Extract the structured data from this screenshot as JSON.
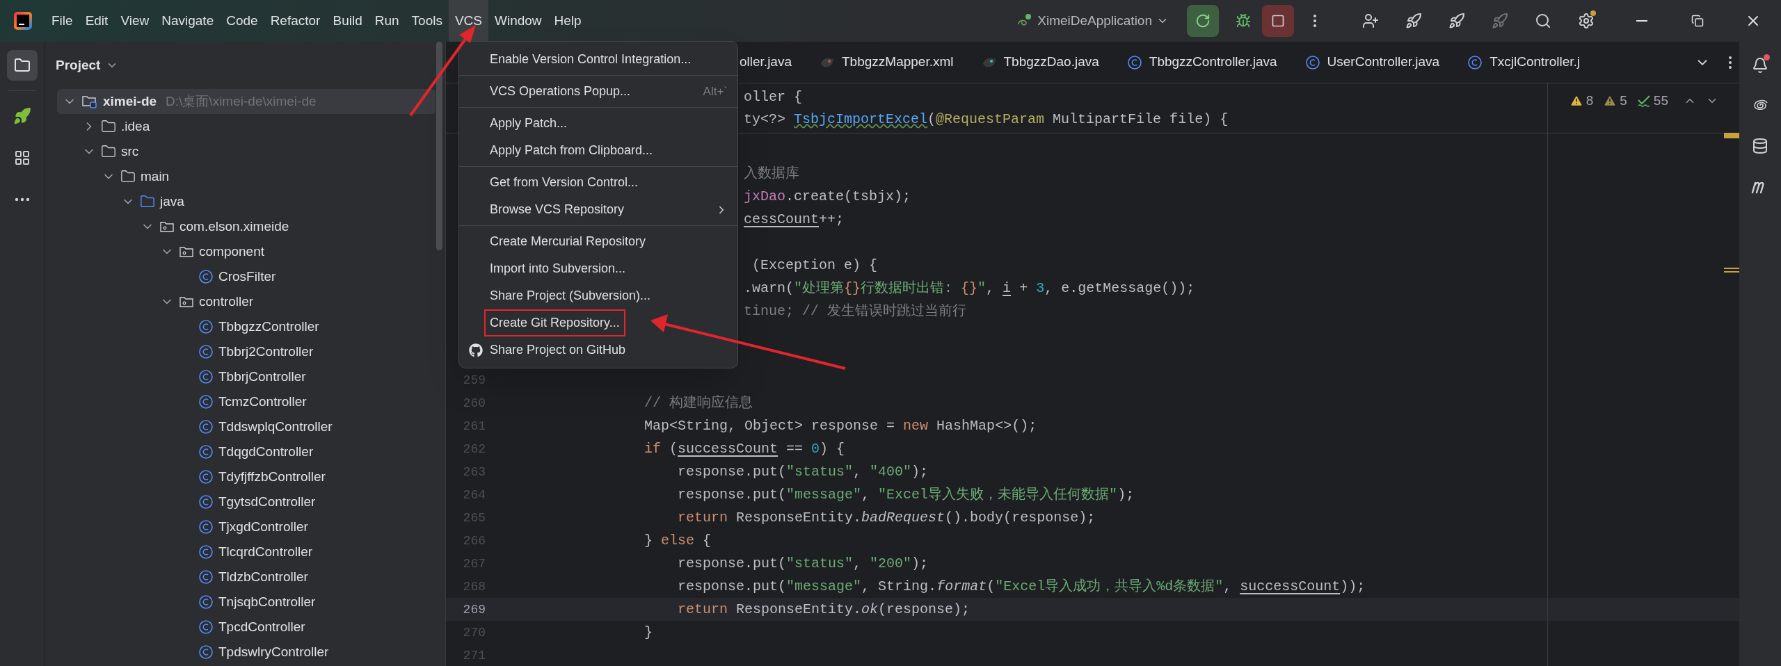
{
  "menu_bar": {
    "items": [
      {
        "label": "File",
        "selected": false
      },
      {
        "label": "Edit",
        "selected": false
      },
      {
        "label": "View",
        "selected": false
      },
      {
        "label": "Navigate",
        "selected": false
      },
      {
        "label": "Code",
        "selected": false
      },
      {
        "label": "Refactor",
        "selected": false
      },
      {
        "label": "Build",
        "selected": false
      },
      {
        "label": "Run",
        "selected": false
      },
      {
        "label": "Tools",
        "selected": false
      },
      {
        "label": "VCS",
        "selected": true
      },
      {
        "label": "Window",
        "selected": false
      },
      {
        "label": "Help",
        "selected": false
      }
    ]
  },
  "run_config": {
    "label": "XimeiDeApplication"
  },
  "project_panel": {
    "title": "Project",
    "tree": [
      {
        "label": "ximei-de",
        "path": "D:\\桌面\\ximei-de\\ximei-de",
        "kind": "module",
        "expanded": true,
        "selected": true,
        "children": [
          {
            "label": ".idea",
            "kind": "folder",
            "expanded": false,
            "selected": false
          },
          {
            "label": "src",
            "kind": "folder",
            "expanded": true,
            "selected": false,
            "children": [
              {
                "label": "main",
                "kind": "folder",
                "expanded": true,
                "selected": false,
                "children": [
                  {
                    "label": "java",
                    "kind": "source-root",
                    "expanded": true,
                    "selected": false,
                    "children": [
                      {
                        "label": "com.elson.ximeide",
                        "kind": "package",
                        "expanded": true,
                        "selected": false,
                        "children": [
                          {
                            "label": "component",
                            "kind": "package",
                            "expanded": true,
                            "selected": false,
                            "children": [
                              {
                                "label": "CrosFilter",
                                "kind": "class",
                                "selected": false
                              }
                            ]
                          },
                          {
                            "label": "controller",
                            "kind": "package",
                            "expanded": true,
                            "selected": false,
                            "children": [
                              {
                                "label": "TbbgzzController",
                                "kind": "class",
                                "selected": false
                              },
                              {
                                "label": "Tbbrj2Controller",
                                "kind": "class",
                                "selected": false
                              },
                              {
                                "label": "TbbrjController",
                                "kind": "class",
                                "selected": false
                              },
                              {
                                "label": "TcmzController",
                                "kind": "class",
                                "selected": false
                              },
                              {
                                "label": "TddswplqController",
                                "kind": "class",
                                "selected": false
                              },
                              {
                                "label": "TdqgdController",
                                "kind": "class",
                                "selected": false
                              },
                              {
                                "label": "TdyfjffzbController",
                                "kind": "class",
                                "selected": false
                              },
                              {
                                "label": "TgytsdController",
                                "kind": "class",
                                "selected": false
                              },
                              {
                                "label": "TjxgdController",
                                "kind": "class",
                                "selected": false
                              },
                              {
                                "label": "TlcqrdController",
                                "kind": "class",
                                "selected": false
                              },
                              {
                                "label": "TldzbController",
                                "kind": "class",
                                "selected": false
                              },
                              {
                                "label": "TnjsqbController",
                                "kind": "class",
                                "selected": false
                              },
                              {
                                "label": "TpcdController",
                                "kind": "class",
                                "selected": false
                              },
                              {
                                "label": "TpdswlryController",
                                "kind": "class",
                                "selected": false
                              }
                            ]
                          }
                        ]
                      }
                    ]
                  }
                ]
              }
            ]
          }
        ]
      }
    ]
  },
  "editor_tabs": [
    {
      "label": "oller.java",
      "kind": "plain"
    },
    {
      "label": "TbbgzzMapper.xml",
      "kind": "mapper"
    },
    {
      "label": "TbbgzzDao.java",
      "kind": "dao"
    },
    {
      "label": "TbbgzzController.java",
      "kind": "class"
    },
    {
      "label": "UserController.java",
      "kind": "class"
    },
    {
      "label": "TxcjlController.j",
      "kind": "class"
    }
  ],
  "inspections": [
    {
      "kind": "warning",
      "count": "8"
    },
    {
      "kind": "weak-warning",
      "count": "5"
    },
    {
      "kind": "typo",
      "count": "55"
    }
  ],
  "sticky_lines": [
    {
      "tokens": [
        {
          "kind": "plain",
          "text": "oller {"
        }
      ]
    },
    {
      "tokens": [
        {
          "kind": "plain",
          "text": "ty<?> "
        },
        {
          "kind": "decl",
          "text": "TsbjcImportExcel"
        },
        {
          "kind": "plain",
          "text": "("
        },
        {
          "kind": "annotation",
          "text": "@RequestParam"
        },
        {
          "kind": "plain",
          "text": " MultipartFile file) {"
        }
      ]
    }
  ],
  "code_lines": [
    {
      "kind": "partial"
    },
    {
      "kind": "partial",
      "tokens": [
        {
          "kind": "comment",
          "text": "入数据库"
        }
      ]
    },
    {
      "kind": "partial",
      "tokens": [
        {
          "kind": "field",
          "text": "jxDao"
        },
        {
          "kind": "plain",
          "text": ".create(tsbjx);"
        }
      ]
    },
    {
      "kind": "partial",
      "tokens": [
        {
          "kind": "underline",
          "text": "cessCount"
        },
        {
          "kind": "plain",
          "text": "++;"
        }
      ]
    },
    {
      "kind": "partial"
    },
    {
      "kind": "partial",
      "tokens": [
        {
          "kind": "plain",
          "text": " (Exception e) {"
        }
      ]
    },
    {
      "kind": "partial",
      "tokens": [
        {
          "kind": "plain",
          "text": ".warn("
        },
        {
          "kind": "string",
          "text": "\"处理第"
        },
        {
          "kind": "brace",
          "text": "{}"
        },
        {
          "kind": "string",
          "text": "行数据时出错: "
        },
        {
          "kind": "brace",
          "text": "{}"
        },
        {
          "kind": "string",
          "text": "\""
        },
        {
          "kind": "plain",
          "text": ", "
        },
        {
          "kind": "underline",
          "text": "i"
        },
        {
          "kind": "plain",
          "text": " + "
        },
        {
          "kind": "number",
          "text": "3"
        },
        {
          "kind": "plain",
          "text": ", e.getMessage());"
        }
      ]
    },
    {
      "kind": "partial",
      "tokens": [
        {
          "kind": "dim",
          "text": "tinue; "
        },
        {
          "kind": "comment",
          "text": "// 发生错误时跳过当前行"
        }
      ]
    },
    {
      "kind": "partial"
    },
    {
      "kind": "partial"
    },
    {
      "kind": "numbered",
      "number": "259",
      "current": false
    },
    {
      "kind": "numbered",
      "number": "260",
      "current": false,
      "tokens": [
        {
          "kind": "comment",
          "text": "            // 构建响应信息"
        }
      ]
    },
    {
      "kind": "numbered",
      "number": "261",
      "current": false,
      "tokens": [
        {
          "kind": "plain",
          "text": "            Map<String, Object> response = "
        },
        {
          "kind": "keyword",
          "text": "new"
        },
        {
          "kind": "plain",
          "text": " HashMap<>();"
        }
      ]
    },
    {
      "kind": "numbered",
      "number": "262",
      "current": false,
      "tokens": [
        {
          "kind": "keyword",
          "text": "            if"
        },
        {
          "kind": "plain",
          "text": " ("
        },
        {
          "kind": "underline",
          "text": "successCount"
        },
        {
          "kind": "plain",
          "text": " == "
        },
        {
          "kind": "number",
          "text": "0"
        },
        {
          "kind": "plain",
          "text": ") {"
        }
      ]
    },
    {
      "kind": "numbered",
      "number": "263",
      "current": false,
      "tokens": [
        {
          "kind": "plain",
          "text": "                response.put("
        },
        {
          "kind": "string",
          "text": "\"status\""
        },
        {
          "kind": "plain",
          "text": ", "
        },
        {
          "kind": "string",
          "text": "\"400\""
        },
        {
          "kind": "plain",
          "text": ");"
        }
      ]
    },
    {
      "kind": "numbered",
      "number": "264",
      "current": false,
      "tokens": [
        {
          "kind": "plain",
          "text": "                response.put("
        },
        {
          "kind": "string",
          "text": "\"message\""
        },
        {
          "kind": "plain",
          "text": ", "
        },
        {
          "kind": "string",
          "text": "\"Excel导入失败，未能导入任何数据\""
        },
        {
          "kind": "plain",
          "text": ");"
        }
      ]
    },
    {
      "kind": "numbered",
      "number": "265",
      "current": false,
      "tokens": [
        {
          "kind": "keyword",
          "text": "                return"
        },
        {
          "kind": "plain",
          "text": " ResponseEntity."
        },
        {
          "kind": "italic",
          "text": "badRequest"
        },
        {
          "kind": "plain",
          "text": "().body(response);"
        }
      ]
    },
    {
      "kind": "numbered",
      "number": "266",
      "current": false,
      "tokens": [
        {
          "kind": "plain",
          "text": "            } "
        },
        {
          "kind": "keyword",
          "text": "else"
        },
        {
          "kind": "plain",
          "text": " {"
        }
      ]
    },
    {
      "kind": "numbered",
      "number": "267",
      "current": false,
      "tokens": [
        {
          "kind": "plain",
          "text": "                response.put("
        },
        {
          "kind": "string",
          "text": "\"status\""
        },
        {
          "kind": "plain",
          "text": ", "
        },
        {
          "kind": "string",
          "text": "\"200\""
        },
        {
          "kind": "plain",
          "text": ");"
        }
      ]
    },
    {
      "kind": "numbered",
      "number": "268",
      "current": false,
      "tokens": [
        {
          "kind": "plain",
          "text": "                response.put("
        },
        {
          "kind": "string",
          "text": "\"message\""
        },
        {
          "kind": "plain",
          "text": ", String."
        },
        {
          "kind": "italic",
          "text": "format"
        },
        {
          "kind": "plain",
          "text": "("
        },
        {
          "kind": "string",
          "text": "\"Excel导入成功，共导入%d条数据\""
        },
        {
          "kind": "plain",
          "text": ", "
        },
        {
          "kind": "underline",
          "text": "successCount"
        },
        {
          "kind": "plain",
          "text": "));"
        }
      ]
    },
    {
      "kind": "numbered",
      "number": "269",
      "current": true,
      "tokens": [
        {
          "kind": "keyword",
          "text": "                return"
        },
        {
          "kind": "plain",
          "text": " ResponseEntity."
        },
        {
          "kind": "italic",
          "text": "ok"
        },
        {
          "kind": "plain",
          "text": "(response);"
        }
      ]
    },
    {
      "kind": "numbered",
      "number": "270",
      "current": false,
      "tokens": [
        {
          "kind": "plain",
          "text": "            }"
        }
      ]
    },
    {
      "kind": "numbered",
      "number": "271",
      "current": false
    }
  ],
  "vcs_menu": {
    "groups": [
      [
        {
          "label": "Enable Version Control Integration...",
          "kind": "plain",
          "highlighted": false
        }
      ],
      [
        {
          "label": "VCS Operations Popup...",
          "shortcut": "Alt+`",
          "kind": "plain",
          "highlighted": false
        }
      ],
      [
        {
          "label": "Apply Patch...",
          "kind": "plain",
          "highlighted": false
        },
        {
          "label": "Apply Patch from Clipboard...",
          "kind": "plain",
          "highlighted": false
        }
      ],
      [
        {
          "label": "Get from Version Control...",
          "kind": "plain",
          "highlighted": false
        },
        {
          "label": "Browse VCS Repository",
          "kind": "submenu",
          "highlighted": false
        }
      ],
      [
        {
          "label": "Create Mercurial Repository",
          "kind": "plain",
          "highlighted": false
        },
        {
          "label": "Import into Subversion...",
          "kind": "plain",
          "highlighted": false
        },
        {
          "label": "Share Project (Subversion)...",
          "kind": "plain",
          "highlighted": false
        },
        {
          "label": "Create Git Repository...",
          "kind": "plain",
          "highlighted": true
        },
        {
          "label": "Share Project on GitHub",
          "kind": "github",
          "highlighted": false
        }
      ]
    ]
  }
}
